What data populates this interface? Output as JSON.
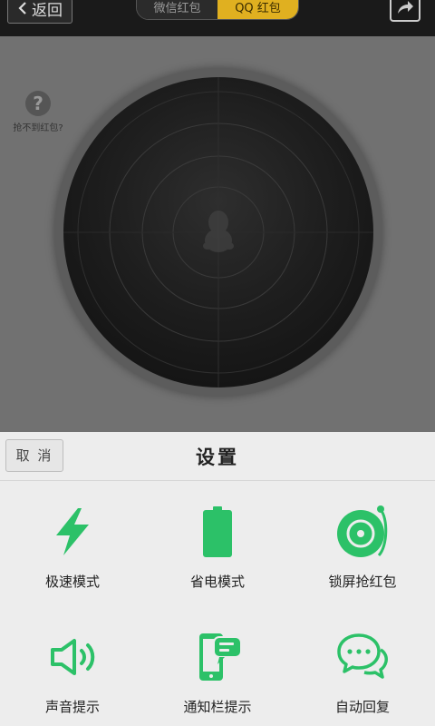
{
  "topbar": {
    "back_label": "返回",
    "tabs": [
      {
        "label": "微信红包",
        "active": false
      },
      {
        "label": "QQ 红包",
        "active": true
      }
    ]
  },
  "main": {
    "help_label": "抢不到红包?",
    "help_glyph": "?"
  },
  "sheet": {
    "cancel_label": "取 消",
    "title": "设置",
    "options": [
      {
        "label": "极速模式",
        "icon": "lightning-icon"
      },
      {
        "label": "省电模式",
        "icon": "battery-icon"
      },
      {
        "label": "锁屏抢红包",
        "icon": "lock-screen-disc-icon"
      },
      {
        "label": "声音提示",
        "icon": "speaker-icon"
      },
      {
        "label": "通知栏提示",
        "icon": "phone-message-icon"
      },
      {
        "label": "自动回复",
        "icon": "chat-bubbles-icon"
      }
    ]
  },
  "colors": {
    "accent_green": "#2cc168",
    "tab_active": "#e0b020"
  }
}
